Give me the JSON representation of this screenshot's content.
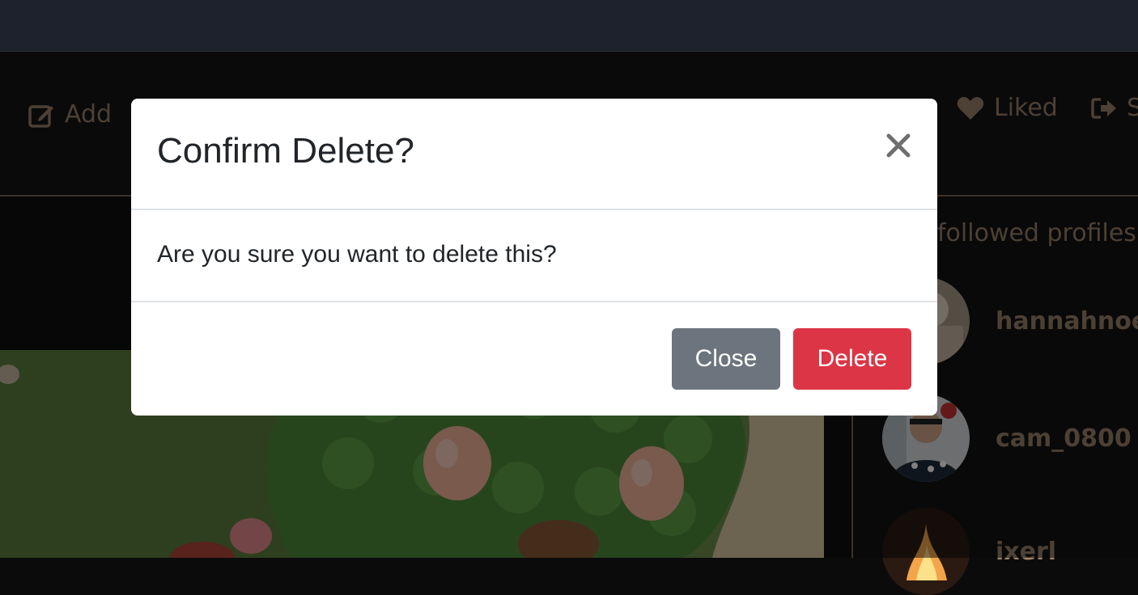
{
  "navbar": {
    "add_label": "Add",
    "add_icon": "edit-icon",
    "liked_label": "Liked",
    "liked_icon": "heart-icon",
    "signout_label": "S",
    "signout_icon": "sign-out-icon"
  },
  "sidebar": {
    "heading": "followed profiles.",
    "profiles": [
      {
        "name": "hannahnoe"
      },
      {
        "name": "cam_0800"
      },
      {
        "name": "ixerl"
      }
    ]
  },
  "modal": {
    "title": "Confirm Delete?",
    "body": "Are you sure you want to delete this?",
    "close_icon": "close-icon",
    "close_label": "Close",
    "delete_label": "Delete"
  },
  "colors": {
    "accent_text": "#9a8168",
    "danger": "#dc3545",
    "secondary": "#6c757d",
    "browser_bar": "#3c4558"
  }
}
